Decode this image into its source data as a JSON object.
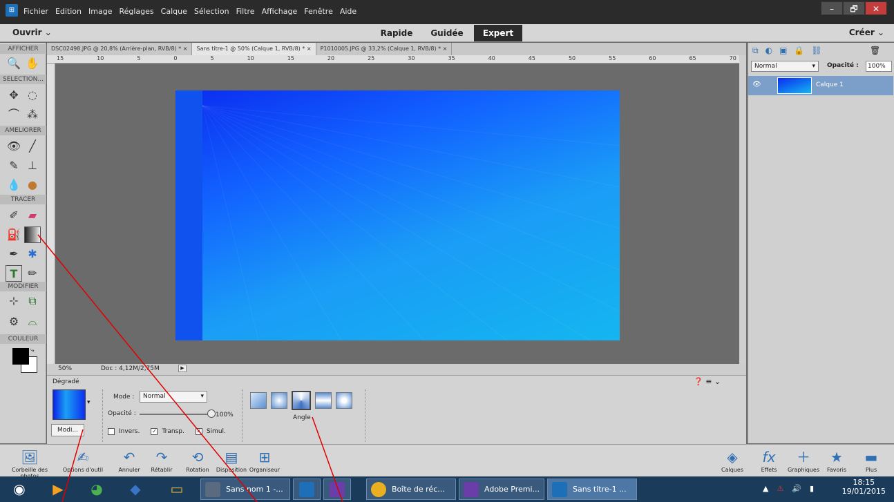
{
  "app": {
    "icon": "photoshop-elements-icon",
    "menu": [
      "Fichier",
      "Edition",
      "Image",
      "Réglages",
      "Calque",
      "Sélection",
      "Filtre",
      "Affichage",
      "Fenêtre",
      "Aide"
    ]
  },
  "window_buttons": [
    "–",
    "🗗",
    "✕"
  ],
  "modebar": {
    "open": "Ouvrir",
    "create": "Créer",
    "modes": [
      "Rapide",
      "Guidée",
      "Expert"
    ],
    "active": "Expert"
  },
  "toolbox": {
    "sections": [
      "AFFICHER",
      "SELECTION...",
      "AMELIORER",
      "TRACER",
      "MODIFIER",
      "COULEUR"
    ]
  },
  "tabs": [
    "DSC02498.JPG @ 20,8% (Arrière-plan, RVB/8) * ×",
    "Sans titre-1 @ 50% (Calque 1, RVB/8) * ×",
    "P1010005.JPG @ 33,2% (Calque 1, RVB/8) * ×"
  ],
  "ruler_marks": [
    "15",
    "10",
    "5",
    "0",
    "5",
    "10",
    "15",
    "20",
    "25",
    "30",
    "35",
    "40",
    "45",
    "50",
    "55",
    "60",
    "65",
    "70"
  ],
  "status": {
    "zoom": "50%",
    "doc": "Doc : 4,12M/2,75M"
  },
  "options": {
    "tool_name": "Dégradé",
    "modify_label": "Modi...",
    "mode_label": "Mode :",
    "mode_value": "Normal",
    "opacity_label": "Opacité :",
    "opacity_value": "100%",
    "opacity_level": 1.0,
    "invert_label": "Invers.",
    "invert_checked": false,
    "transp_label": "Transp.",
    "transp_checked": true,
    "simul_label": "Simul.",
    "simul_checked": true,
    "gradient_type_selected": "Angle",
    "gradient_types": [
      "Linéaire",
      "Radial",
      "Angle",
      "Réfléchi",
      "Losange"
    ]
  },
  "layers": {
    "blend_mode": "Normal",
    "opacity_label": "Opacité :",
    "opacity_value": "100%",
    "layer_name": "Calque 1"
  },
  "bottombar": {
    "left": [
      "Corbeille des photos",
      "Options d'outil",
      "Annuler",
      "Rétablir",
      "Rotation",
      "Disposition",
      "Organiseur"
    ],
    "right": [
      "Calques",
      "Effets",
      "Graphiques",
      "Favoris",
      "Plus"
    ]
  },
  "taskbar": {
    "tasks": [
      "Sans nom 1 -...",
      "",
      "",
      "Boîte de réc...",
      "Adobe Premi...",
      "Sans titre-1 ..."
    ],
    "time": "18:15",
    "date": "19/01/2015"
  },
  "colors": {
    "accent": "#1d6fb8",
    "canvas_dark": "#0b2cf0",
    "canvas_light": "#14b6f0",
    "annotation": "#e00000"
  }
}
